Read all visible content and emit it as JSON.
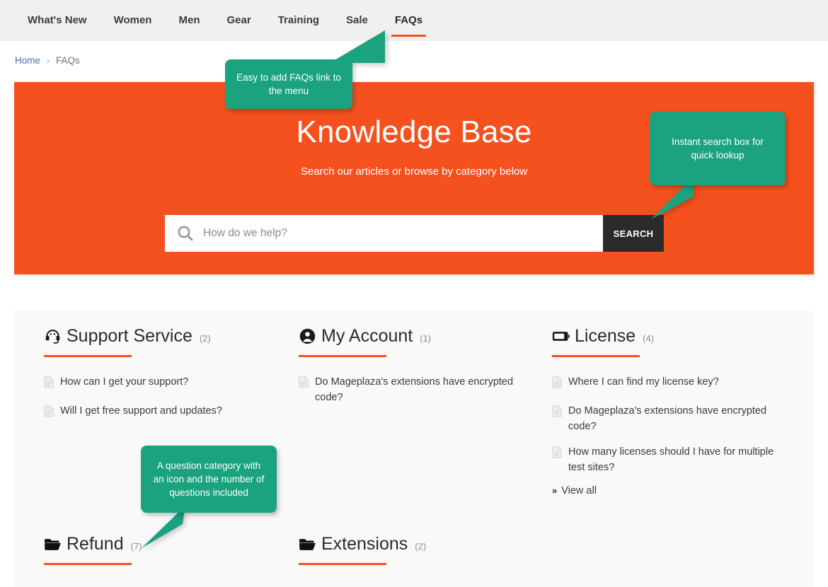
{
  "nav": {
    "items": [
      {
        "label": "What's New",
        "active": false
      },
      {
        "label": "Women",
        "active": false
      },
      {
        "label": "Men",
        "active": false
      },
      {
        "label": "Gear",
        "active": false
      },
      {
        "label": "Training",
        "active": false
      },
      {
        "label": "Sale",
        "active": false
      },
      {
        "label": "FAQs",
        "active": true
      }
    ]
  },
  "breadcrumb": {
    "home": "Home",
    "separator": "›",
    "current": "FAQs"
  },
  "hero": {
    "title": "Knowledge Base",
    "subtitle": "Search our articles or browse by category below",
    "background_color": "#f4511e",
    "search": {
      "placeholder": "How do we help?",
      "value": "",
      "button_label": "SEARCH",
      "icon": "search-icon"
    }
  },
  "categories": [
    {
      "name": "Support Service",
      "count": "(2)",
      "icon": "headset-icon",
      "questions": [
        "How can I get your support?",
        "Will I get free support and updates?"
      ],
      "view_all": null
    },
    {
      "name": "My Account",
      "count": "(1)",
      "icon": "user-circle-icon",
      "questions": [
        "Do Mageplaza's extensions have encrypted code?"
      ],
      "view_all": null
    },
    {
      "name": "License",
      "count": "(4)",
      "icon": "license-card-icon",
      "questions": [
        "Where I can find my license key?",
        "Do Mageplaza's extensions have encrypted code?",
        "How many licenses should I have for multiple test sites?"
      ],
      "view_all": "View all"
    },
    {
      "name": "Refund",
      "count": "(7)",
      "icon": "folder-open-icon",
      "questions": [],
      "view_all": null
    },
    {
      "name": "Extensions",
      "count": "(2)",
      "icon": "folder-open-icon",
      "questions": [],
      "view_all": null
    }
  ],
  "callouts": [
    {
      "id": "menu",
      "text": "Easy to add FAQs link to the menu"
    },
    {
      "id": "search",
      "text": "Instant search box for quick lookup"
    },
    {
      "id": "category",
      "text": "A question category with an icon and the number of questions included"
    }
  ],
  "colors": {
    "brand_orange": "#f4511e",
    "callout_green": "#1aa37e",
    "nav_background": "#f0f0f0",
    "panel_background": "#f9f9f9",
    "link_blue": "#4a72ab",
    "search_button": "#2b2b2b"
  }
}
